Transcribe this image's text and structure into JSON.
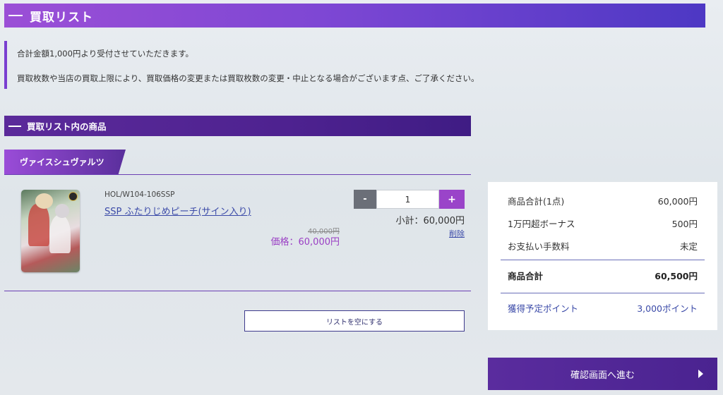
{
  "header": {
    "title": "買取リスト"
  },
  "notice": {
    "line1": "合計金額1,000円より受付させていただきます。",
    "line2": "買取枚数や当店の買取上限により、買取価格の変更または買取枚数の変更・中止となる場合がございます点、ご了承ください。"
  },
  "section": {
    "title": "買取リスト内の商品"
  },
  "category": {
    "label": "ヴァイスシュヴァルツ"
  },
  "item": {
    "code": "HOL/W104-106SSP",
    "name": "SSP ふたりじめピーチ(サイン入り)",
    "price_original": "40,000円",
    "price_current": "価格：60,000円",
    "quantity": "1",
    "subtotal": "小計：60,000円",
    "delete_label": "削除",
    "minus_label": "-",
    "plus_label": "+"
  },
  "clear_button": {
    "label": "リストを空にする"
  },
  "summary": {
    "rows": [
      {
        "label": "商品合計(1点)",
        "value": "60,000円"
      },
      {
        "label": "1万円超ボーナス",
        "value": "500円"
      },
      {
        "label": "お支払い手数料",
        "value": "未定"
      }
    ],
    "total_label": "商品合計",
    "total_value": "60,500円",
    "points_label": "獲得予定ポイント",
    "points_value": "3,000ポイント"
  },
  "confirm_button": {
    "label": "確認画面へ進む"
  }
}
